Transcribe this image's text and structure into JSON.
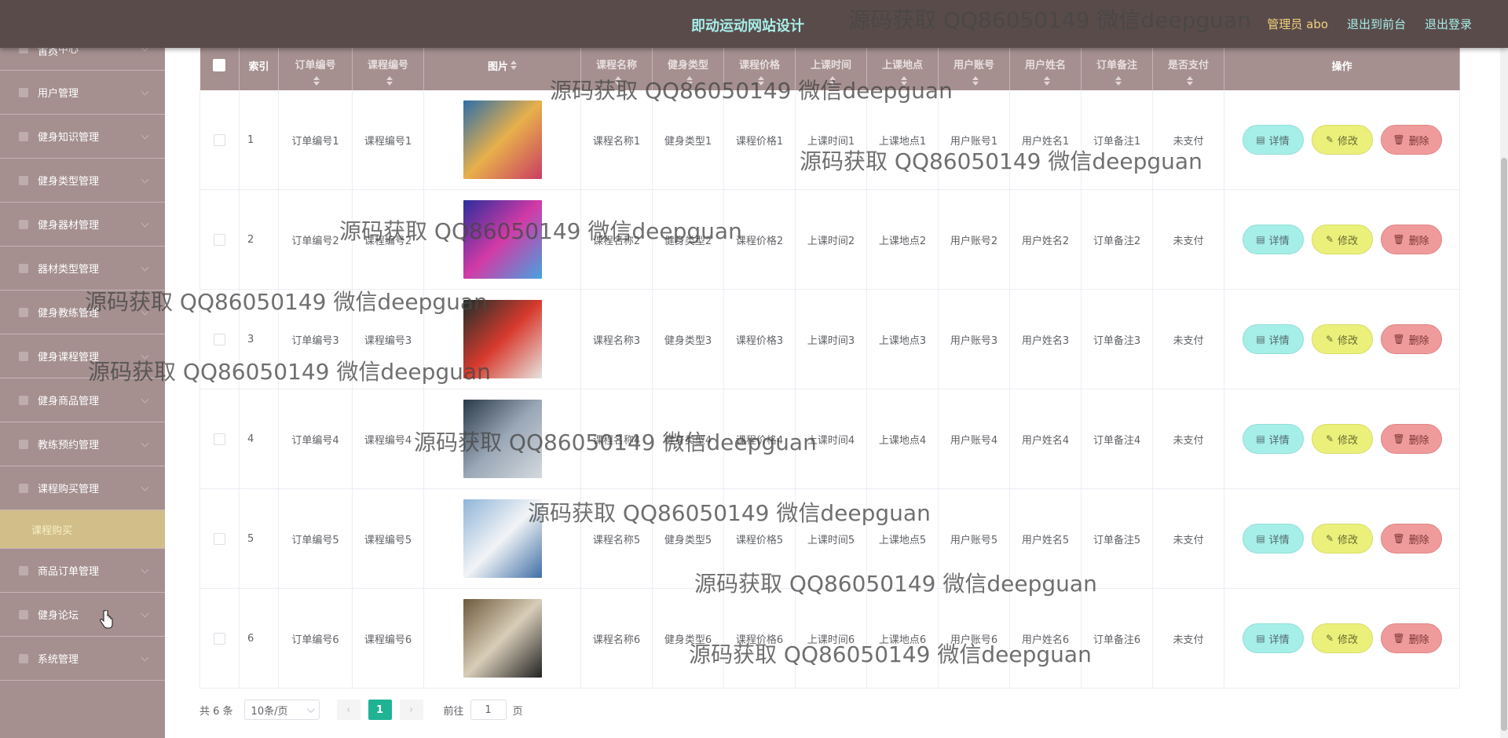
{
  "header": {
    "title": "即动运动网站设计",
    "admin": "管理员 abo",
    "to_front": "退出到前台",
    "logout": "退出登录"
  },
  "sidebar": {
    "items": [
      {
        "label": "首页",
        "icon": "home-icon"
      },
      {
        "label": "个人中心",
        "icon": "user-icon"
      },
      {
        "label": "用户管理",
        "icon": "grid-icon"
      },
      {
        "label": "健身知识管理",
        "icon": "book-icon"
      },
      {
        "label": "健身类型管理",
        "icon": "tag-icon"
      },
      {
        "label": "健身器材管理",
        "icon": "person-icon"
      },
      {
        "label": "器材类型管理",
        "icon": "chart-icon"
      },
      {
        "label": "健身教练管理",
        "icon": "circle-icon"
      },
      {
        "label": "健身课程管理",
        "icon": "file-icon"
      },
      {
        "label": "健身商品管理",
        "icon": "flag-icon"
      },
      {
        "label": "教练预约管理",
        "icon": "list-icon"
      },
      {
        "label": "课程购买管理",
        "icon": "circle-icon"
      }
    ],
    "active_sub": "课程购买",
    "items_after": [
      {
        "label": "商品订单管理",
        "icon": "receipt-icon"
      },
      {
        "label": "健身论坛",
        "icon": "forum-icon"
      },
      {
        "label": "系统管理",
        "icon": "settings-icon"
      }
    ]
  },
  "table": {
    "headers": [
      "索引",
      "订单编号",
      "课程编号",
      "图片",
      "课程名称",
      "健身类型",
      "课程价格",
      "上课时间",
      "上课地点",
      "用户账号",
      "用户姓名",
      "订单备注",
      "是否支付",
      "操作"
    ],
    "rows": [
      {
        "idx": "1",
        "order": "订单编号1",
        "course_no": "课程编号1",
        "name": "课程名称1",
        "type": "健身类型1",
        "price": "课程价格1",
        "time": "上课时间1",
        "place": "上课地点1",
        "account": "用户账号1",
        "username": "用户姓名1",
        "note": "订单备注1",
        "paid": "未支付"
      },
      {
        "idx": "2",
        "order": "订单编号2",
        "course_no": "课程编号2",
        "name": "课程名称2",
        "type": "健身类型2",
        "price": "课程价格2",
        "time": "上课时间2",
        "place": "上课地点2",
        "account": "用户账号2",
        "username": "用户姓名2",
        "note": "订单备注2",
        "paid": "未支付"
      },
      {
        "idx": "3",
        "order": "订单编号3",
        "course_no": "课程编号3",
        "name": "课程名称3",
        "type": "健身类型3",
        "price": "课程价格3",
        "time": "上课时间3",
        "place": "上课地点3",
        "account": "用户账号3",
        "username": "用户姓名3",
        "note": "订单备注3",
        "paid": "未支付"
      },
      {
        "idx": "4",
        "order": "订单编号4",
        "course_no": "课程编号4",
        "name": "课程名称4",
        "type": "健身类型4",
        "price": "课程价格4",
        "time": "上课时间4",
        "place": "上课地点4",
        "account": "用户账号4",
        "username": "用户姓名4",
        "note": "订单备注4",
        "paid": "未支付"
      },
      {
        "idx": "5",
        "order": "订单编号5",
        "course_no": "课程编号5",
        "name": "课程名称5",
        "type": "健身类型5",
        "price": "课程价格5",
        "time": "上课时间5",
        "place": "上课地点5",
        "account": "用户账号5",
        "username": "用户姓名5",
        "note": "订单备注5",
        "paid": "未支付"
      },
      {
        "idx": "6",
        "order": "订单编号6",
        "course_no": "课程编号6",
        "name": "课程名称6",
        "type": "健身类型6",
        "price": "课程价格6",
        "time": "上课时间6",
        "place": "上课地点6",
        "account": "用户账号6",
        "username": "用户姓名6",
        "note": "订单备注6",
        "paid": "未支付"
      }
    ],
    "actions": {
      "detail": "详情",
      "edit": "修改",
      "delete": "删除"
    }
  },
  "pagination": {
    "total": "共 6 条",
    "page_size": "10条/页",
    "current_page": "1",
    "goto_label": "前往",
    "goto_value": "1",
    "page_unit": "页"
  },
  "watermark": "源码获取 QQ86050149 微信deepguan",
  "colors": {
    "topbar": "#5a4b4b",
    "sidebar": "#a58f8f",
    "active_submenu": "#d2be88",
    "detail_button": "#a6eee8",
    "edit_button": "#eaf07a",
    "delete_button": "#f09b9b",
    "current_page": "#1fb394"
  }
}
